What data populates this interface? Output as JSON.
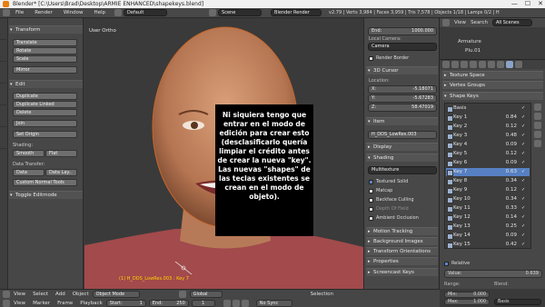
{
  "window": {
    "title": "Blender* [C:\\Users\\Brad\\Desktop\\ARMIE ENHANCED\\shapekeys.blend]",
    "controls": [
      "—",
      "☐",
      "✕"
    ]
  },
  "info_header": {
    "menus": [
      "File",
      "Render",
      "Window",
      "Help"
    ],
    "layout": "Default",
    "scene": "Scene",
    "engine": "Blender Render",
    "stats": "v2.79 | Verts 3,984 | Faces 3,959 | Tris 7,578 | Objects 1/18 | Lamps 0/2 | H"
  },
  "tool_shelf": {
    "transform_header": "Transform",
    "transform_buttons": [
      "Translate",
      "Rotate",
      "Scale",
      "Mirror"
    ],
    "edit_header": "Edit",
    "edit_buttons": [
      "Duplicate",
      "Duplicate Linked",
      "Delete",
      "Join"
    ],
    "set_origin": "Set Origin",
    "shading_label": "Shading:",
    "shading_smooth": "Smooth",
    "shading_flat": "Flat",
    "data_transfer_label": "Data Transfer:",
    "data_btn": "Data",
    "data_layout_btn": "Data Lay..",
    "custom_normal": "Custom Normal Tools",
    "toggle_editmode": "Toggle Editmode"
  },
  "viewport": {
    "label": "User Ortho",
    "object_label": "(1) H_DDS_LowRes.003 : Key 7"
  },
  "subtitle": {
    "text": "Ni siquiera tengo que entrar en el modo de edición para crear esto (desclasificarlo quería limpiar el crédito antes de crear la nueva \"key\". Las nuevas \"shapes\" de las teclas existentes se crean en el modo de objeto)."
  },
  "properties": {
    "end_label": "End:",
    "end_value": "1000.000",
    "local_camera_label": "Local Camera:",
    "camera_value": "Camera",
    "render_border": "Render Border",
    "cursor_header": "3D Cursor",
    "location_label": "Location:",
    "cursor_x_label": "X:",
    "cursor_x": "-5.18071",
    "cursor_y_label": "Y:",
    "cursor_y": "-5.67283",
    "cursor_z_label": "Z:",
    "cursor_z": "58.47019",
    "item_header": "Item",
    "item_name": "H_DDS_LowRes.003",
    "display_header": "Display",
    "shading_header": "Shading",
    "shading_mode": "Multitexture",
    "options": [
      {
        "label": "Textured Solid",
        "on": true
      },
      {
        "label": "Matcap",
        "on": false
      },
      {
        "label": "Backface Culling",
        "on": false
      },
      {
        "label": "Depth Of Field",
        "on": false
      },
      {
        "label": "Ambient Occlusion",
        "on": false
      }
    ],
    "motion_tracking": "Motion Tracking",
    "background_images": "Background Images",
    "transform_orientations": "Transform Orientations",
    "properties_label": "Properties",
    "screencast_keys": "Screencast Keys"
  },
  "outliner": {
    "view": "View",
    "search": "Search",
    "scenes": "All Scenes",
    "items": [
      "Armature",
      "Plu.01"
    ]
  },
  "shape_panel": {
    "texture_space": "Texture Space",
    "vertex_groups": "Vertex Groups",
    "shape_keys_header": "Shape Keys",
    "keys": [
      {
        "name": "Basis",
        "value": ""
      },
      {
        "name": "Key 1",
        "value": "0.84"
      },
      {
        "name": "Key 2",
        "value": "0.12"
      },
      {
        "name": "Key 3",
        "value": "0.48"
      },
      {
        "name": "Key 4",
        "value": "0.09"
      },
      {
        "name": "Key 5",
        "value": "0.12"
      },
      {
        "name": "Key 6",
        "value": "0.09"
      },
      {
        "name": "Key 7",
        "value": "0.63"
      },
      {
        "name": "Key 8",
        "value": "0.34"
      },
      {
        "name": "Key 9",
        "value": "0.12"
      },
      {
        "name": "Key 10",
        "value": "0.34"
      },
      {
        "name": "Key 11",
        "value": "0.33"
      },
      {
        "name": "Key 12",
        "value": "0.14"
      },
      {
        "name": "Key 13",
        "value": "0.25"
      },
      {
        "name": "Key 14",
        "value": "0.09"
      },
      {
        "name": "Key 15",
        "value": "0.42"
      }
    ],
    "selected_index": 7,
    "relative": "Relative",
    "value_label": "Value:",
    "value": "0.639",
    "range_label": "Range:",
    "blend_label": "Blend:",
    "min": "Min:",
    "min_value": "0.000",
    "max": "Max:",
    "max_value": "1.000",
    "blend_value": "Basis"
  },
  "timeline": {
    "row1": [
      "View",
      "Select",
      "Add",
      "Object"
    ],
    "mode": "Object Mode",
    "orientation": "Global",
    "selection": "Selection",
    "row2": [
      "View",
      "Marker",
      "Frame",
      "Playback"
    ],
    "start_label": "Start:",
    "start": "1",
    "end_label": "End:",
    "end": "250",
    "current": "1",
    "sync": "No Sync"
  },
  "colors": {
    "selected_row": "#5680c2",
    "panel_bg": "#474747",
    "accent": "#e87d0d"
  }
}
